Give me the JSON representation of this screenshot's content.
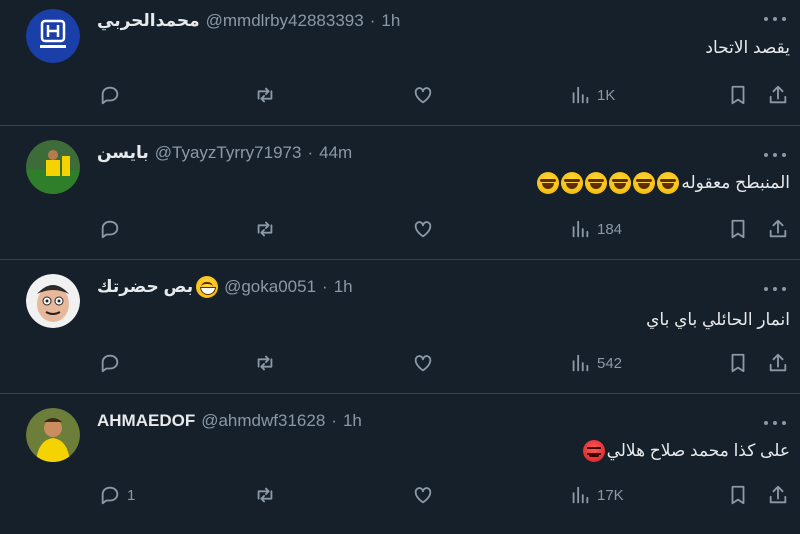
{
  "colors": {
    "background": "#15202b",
    "text": "#e7e9ea",
    "muted": "#8b98a5",
    "divider": "#38444d"
  },
  "tweets": [
    {
      "name": "محمدالحربي",
      "handle": "@mmdlrby42883393",
      "separator": "·",
      "time": "1h",
      "text": "يقصد الاتحاد",
      "emojis": [],
      "reply_count": "",
      "retweet_count": "",
      "like_count": "",
      "views": "1K",
      "avatar": "al-hilal-logo"
    },
    {
      "name": "بايسن",
      "handle": "@TyayzTyrry71973",
      "separator": "·",
      "time": "44m",
      "text": "المنبطح معقوله",
      "emojis": [
        "laugh",
        "laugh",
        "laugh",
        "laugh",
        "laugh",
        "laugh"
      ],
      "reply_count": "",
      "retweet_count": "",
      "like_count": "",
      "views": "184",
      "avatar": "player-photo"
    },
    {
      "name": "بص حضرتك",
      "handle": "@goka0051",
      "separator": "·",
      "time": "1h",
      "text": "انمار الحائلي باي باي",
      "emojis": [],
      "reply_count": "",
      "retweet_count": "",
      "like_count": "",
      "views": "542",
      "avatar": "cartoon-face"
    },
    {
      "name": "AHMAEDOF",
      "handle": "@ahmdwf31628",
      "separator": "·",
      "time": "1h",
      "text": "على كذا محمد صلاح هلالي",
      "emojis": [
        "angry"
      ],
      "reply_count": "1",
      "retweet_count": "",
      "like_count": "",
      "views": "17K",
      "avatar": "player-photo-yellow"
    }
  ]
}
